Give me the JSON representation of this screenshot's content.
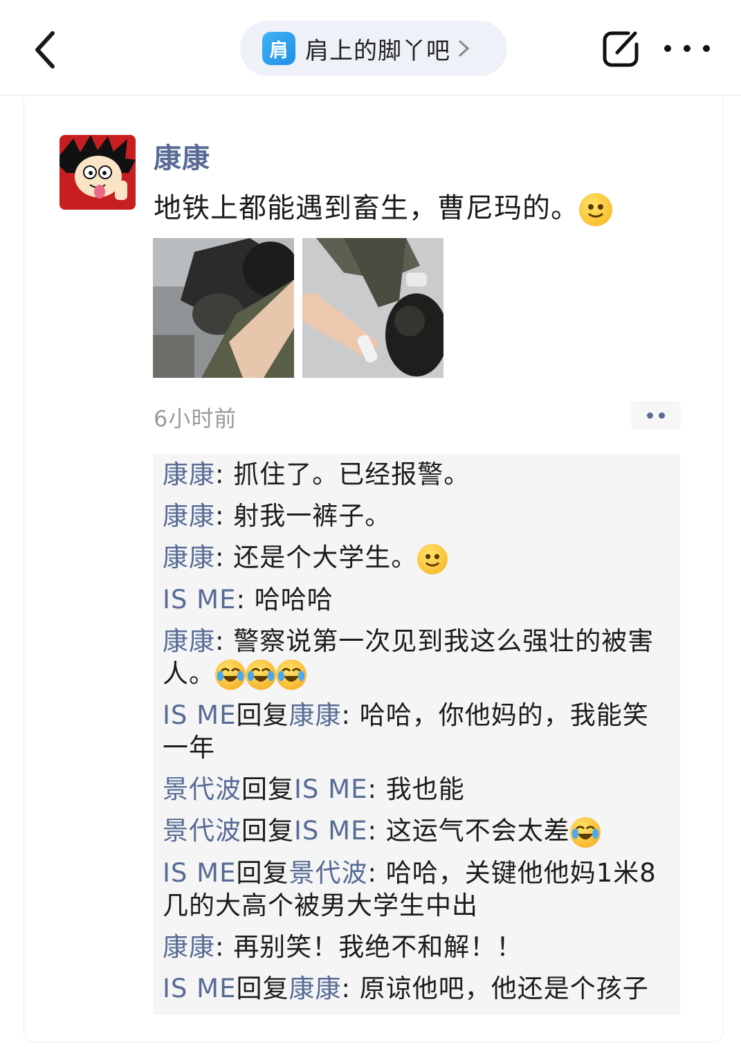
{
  "topbar": {
    "forum_logo_char": "肩",
    "forum_name": "肩上的脚丫吧"
  },
  "post": {
    "author": "康康",
    "text": "地铁上都能遇到畜生，曹尼玛的。",
    "time": "6小时前",
    "images": [
      "photo-1",
      "photo-2"
    ]
  },
  "comments": [
    {
      "author": "康康",
      "reply_label": "",
      "reply_to": "",
      "separator": ": ",
      "text": "抓住了。已经报警。",
      "emoji": []
    },
    {
      "author": "康康",
      "reply_label": "",
      "reply_to": "",
      "separator": ": ",
      "text": "射我一裤子。",
      "emoji": []
    },
    {
      "author": "康康",
      "reply_label": "",
      "reply_to": "",
      "separator": ": ",
      "text": "还是个大学生。",
      "emoji": [
        "smile"
      ]
    },
    {
      "author": "IS ME",
      "reply_label": "",
      "reply_to": "",
      "separator": ": ",
      "text": "哈哈哈",
      "emoji": []
    },
    {
      "author": "康康",
      "reply_label": "",
      "reply_to": "",
      "separator": ": ",
      "text": "警察说第一次见到我这么强壮的被害人。",
      "emoji": [
        "laugh-cry",
        "laugh-cry",
        "laugh-cry"
      ]
    },
    {
      "author": "IS ME",
      "reply_label": "回复",
      "reply_to": "康康",
      "separator": ": ",
      "text": "哈哈，你他妈的，我能笑一年",
      "emoji": []
    },
    {
      "author": "景代波",
      "reply_label": "回复",
      "reply_to": "IS ME",
      "separator": ": ",
      "text": "我也能",
      "emoji": []
    },
    {
      "author": "景代波",
      "reply_label": "回复",
      "reply_to": "IS ME",
      "separator": ": ",
      "text": "这运气不会太差",
      "emoji": [
        "laugh-cry"
      ]
    },
    {
      "author": "IS ME",
      "reply_label": "回复",
      "reply_to": "景代波",
      "separator": ": ",
      "text": "哈哈，关键他他妈1米8几的大高个被男大学生中出",
      "emoji": []
    },
    {
      "author": "康康",
      "reply_label": "",
      "reply_to": "",
      "separator": ": ",
      "text": "再别笑！我绝不和解！！",
      "emoji": []
    },
    {
      "author": "IS ME",
      "reply_label": "回复",
      "reply_to": "康康",
      "separator": ": ",
      "text": "原谅他吧，他还是个孩子",
      "emoji": []
    }
  ]
}
